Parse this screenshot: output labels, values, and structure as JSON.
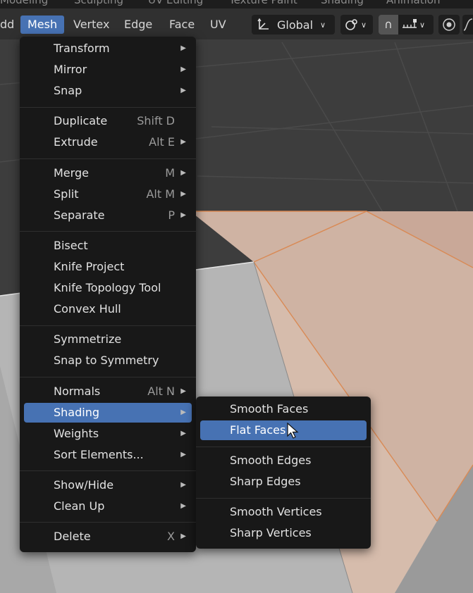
{
  "workspace_tabs": [
    "Modeling",
    "Sculpting",
    "UV Editing",
    "Texture Paint",
    "Shading",
    "Animation"
  ],
  "header": {
    "partial_left": "dd",
    "menus": [
      "Mesh",
      "Vertex",
      "Edge",
      "Face",
      "UV"
    ],
    "active_menu": "Mesh",
    "orientation": "Global"
  },
  "mesh_menu": {
    "groups": [
      [
        {
          "label": "Transform",
          "submenu": true
        },
        {
          "label": "Mirror",
          "submenu": true
        },
        {
          "label": "Snap",
          "submenu": true
        }
      ],
      [
        {
          "label": "Duplicate",
          "shortcut": "Shift D"
        },
        {
          "label": "Extrude",
          "shortcut": "Alt E",
          "submenu": true
        }
      ],
      [
        {
          "label": "Merge",
          "shortcut": "M",
          "submenu": true
        },
        {
          "label": "Split",
          "shortcut": "Alt M",
          "submenu": true
        },
        {
          "label": "Separate",
          "shortcut": "P",
          "submenu": true
        }
      ],
      [
        {
          "label": "Bisect"
        },
        {
          "label": "Knife Project"
        },
        {
          "label": "Knife Topology Tool"
        },
        {
          "label": "Convex Hull"
        }
      ],
      [
        {
          "label": "Symmetrize"
        },
        {
          "label": "Snap to Symmetry"
        }
      ],
      [
        {
          "label": "Normals",
          "shortcut": "Alt N",
          "submenu": true
        },
        {
          "label": "Shading",
          "submenu": true,
          "highlighted": true
        },
        {
          "label": "Weights",
          "submenu": true
        },
        {
          "label": "Sort Elements...",
          "submenu": true
        }
      ],
      [
        {
          "label": "Show/Hide",
          "submenu": true
        },
        {
          "label": "Clean Up",
          "submenu": true
        }
      ],
      [
        {
          "label": "Delete",
          "shortcut": "X",
          "submenu": true
        }
      ]
    ]
  },
  "shading_submenu": {
    "groups": [
      [
        {
          "label": "Smooth Faces"
        },
        {
          "label": "Flat Faces",
          "highlighted": true
        }
      ],
      [
        {
          "label": "Smooth Edges"
        },
        {
          "label": "Sharp Edges"
        }
      ],
      [
        {
          "label": "Smooth Vertices"
        },
        {
          "label": "Sharp Vertices"
        }
      ]
    ]
  },
  "colors": {
    "menu_bg": "#181818",
    "highlight": "#4772b3",
    "header_bg": "#303030",
    "selected_face": "#cfb3a3"
  }
}
